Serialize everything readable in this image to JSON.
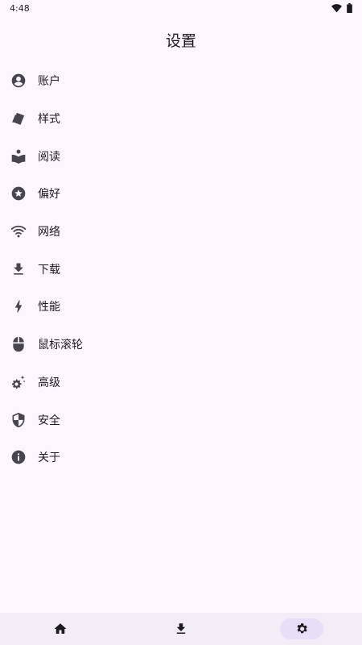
{
  "status_bar": {
    "time": "4:48",
    "icons": [
      "wifi-icon",
      "battery-icon"
    ]
  },
  "header": {
    "title": "设置"
  },
  "menu": {
    "items": [
      {
        "id": "account",
        "label": "账户",
        "icon": "account-circle-icon"
      },
      {
        "id": "style",
        "label": "样式",
        "icon": "style-cards-icon"
      },
      {
        "id": "reading",
        "label": "阅读",
        "icon": "reading-book-icon"
      },
      {
        "id": "preferences",
        "label": "偏好",
        "icon": "star-circle-icon"
      },
      {
        "id": "network",
        "label": "网络",
        "icon": "wifi-icon"
      },
      {
        "id": "download",
        "label": "下载",
        "icon": "download-icon"
      },
      {
        "id": "performance",
        "label": "性能",
        "icon": "lightning-bolt-icon"
      },
      {
        "id": "mouse-wheel",
        "label": "鼠标滚轮",
        "icon": "mouse-icon"
      },
      {
        "id": "advanced",
        "label": "高级",
        "icon": "gears-sparkle-icon"
      },
      {
        "id": "security",
        "label": "安全",
        "icon": "shield-icon"
      },
      {
        "id": "about",
        "label": "关于",
        "icon": "info-icon"
      }
    ]
  },
  "bottom_nav": {
    "items": [
      {
        "id": "home",
        "icon": "home-icon",
        "active": false
      },
      {
        "id": "downloads",
        "icon": "download-icon",
        "active": false
      },
      {
        "id": "settings",
        "icon": "settings-gear-icon",
        "active": true
      }
    ]
  },
  "colors": {
    "background": "#fdf7fd",
    "text": "#1d1b20",
    "icon": "#49454f",
    "nav_background": "#f3edf7",
    "nav_active_pill": "#e8def8"
  }
}
